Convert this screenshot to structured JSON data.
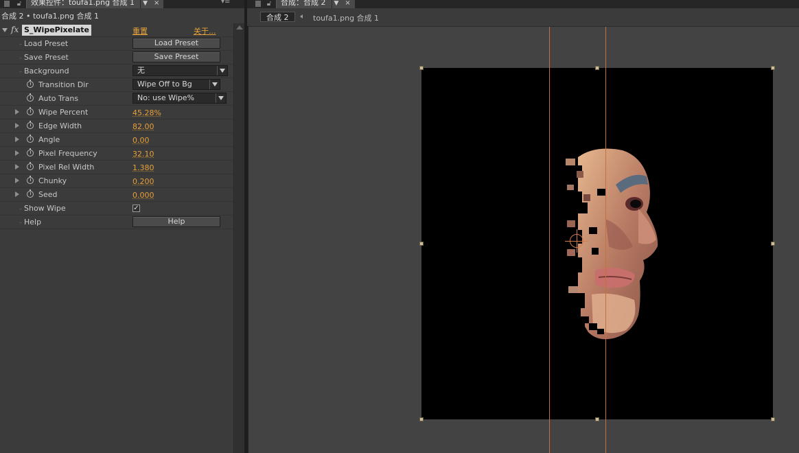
{
  "left_panel": {
    "tab_title": "效果控件：toufa1.png 合成 1",
    "tab_dropdown": "▼",
    "tab_close": "×",
    "panel_menu": "▾≡",
    "header": "合成 2 • toufa1.png 合成 1",
    "effect": {
      "fx_label": "fx",
      "name": "S_WipePixelate",
      "reset_link": "重置",
      "about_link": "关于..."
    },
    "rows": {
      "load_preset": {
        "label": "Load Preset",
        "button": "Load Preset"
      },
      "save_preset": {
        "label": "Save Preset",
        "button": "Save Preset"
      },
      "background": {
        "label": "Background",
        "value": "无"
      },
      "transition_dir": {
        "label": "Transition Dir",
        "value": "Wipe Off to Bg"
      },
      "auto_trans": {
        "label": "Auto Trans",
        "value": "No: use Wipe%"
      },
      "wipe_percent": {
        "label": "Wipe Percent",
        "value": "45.28%"
      },
      "edge_width": {
        "label": "Edge Width",
        "value": "82.00"
      },
      "angle": {
        "label": "Angle",
        "value": "0.00"
      },
      "pixel_frequency": {
        "label": "Pixel Frequency",
        "value": "32.10"
      },
      "pixel_rel_width": {
        "label": "Pixel Rel Width",
        "value": "1.380"
      },
      "chunky": {
        "label": "Chunky",
        "value": "0.200"
      },
      "seed": {
        "label": "Seed",
        "value": "0.000"
      },
      "show_wipe": {
        "label": "Show Wipe",
        "checked": true,
        "mark": "✓"
      },
      "help": {
        "label": "Help",
        "button": "Help"
      }
    }
  },
  "right_panel": {
    "tab_title": "合成：合成 2",
    "tab_dropdown": "▼",
    "tab_close": "×",
    "breadcrumb_active": "合成 2",
    "breadcrumb_next": "toufa1.png 合成 1"
  },
  "colors": {
    "accent_value": "#e6a13a",
    "guide_line": "#c8703a",
    "panel_bg": "#3b3b3b",
    "viewer_bg": "#434343"
  }
}
